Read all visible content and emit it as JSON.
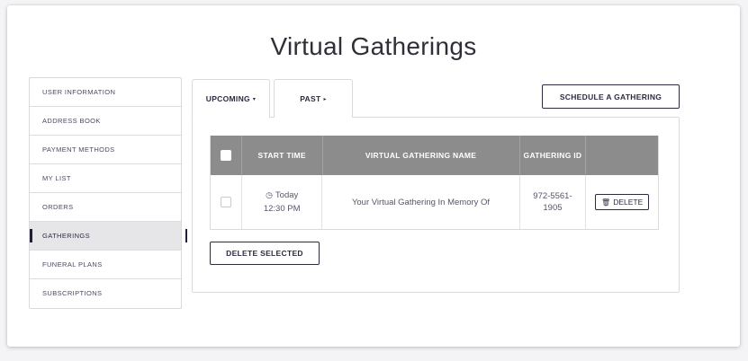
{
  "page": {
    "title": "Virtual Gatherings"
  },
  "sidebar": {
    "items": [
      {
        "label": "USER INFORMATION"
      },
      {
        "label": "ADDRESS BOOK"
      },
      {
        "label": "PAYMENT METHODS"
      },
      {
        "label": "MY LIST"
      },
      {
        "label": "ORDERS"
      },
      {
        "label": "GATHERINGS",
        "active": true
      },
      {
        "label": "FUNERAL PLANS"
      },
      {
        "label": "SUBSCRIPTIONS"
      }
    ]
  },
  "tabs": {
    "upcoming": {
      "label": "UPCOMING",
      "arrow": "▾"
    },
    "past": {
      "label": "PAST",
      "arrow": "▸"
    }
  },
  "actions": {
    "schedule_label": "SCHEDULE A GATHERING",
    "delete_selected_label": "DELETE SELECTED"
  },
  "table": {
    "headers": {
      "start_time": "START TIME",
      "name": "VIRTUAL GATHERING NAME",
      "gathering_id": "GATHERING ID"
    },
    "rows": [
      {
        "day": "Today",
        "time": "12:30 PM",
        "name": "Your Virtual Gathering In Memory Of",
        "id": "972-5561-1905",
        "delete_label": "DELETE"
      }
    ]
  },
  "colors": {
    "header_bg": "#8c8c8c",
    "accent": "#1f1f3a",
    "active_item_bg": "#e6e6e9"
  },
  "icons": {
    "clock": "clock-icon",
    "trash": "trash-icon"
  }
}
